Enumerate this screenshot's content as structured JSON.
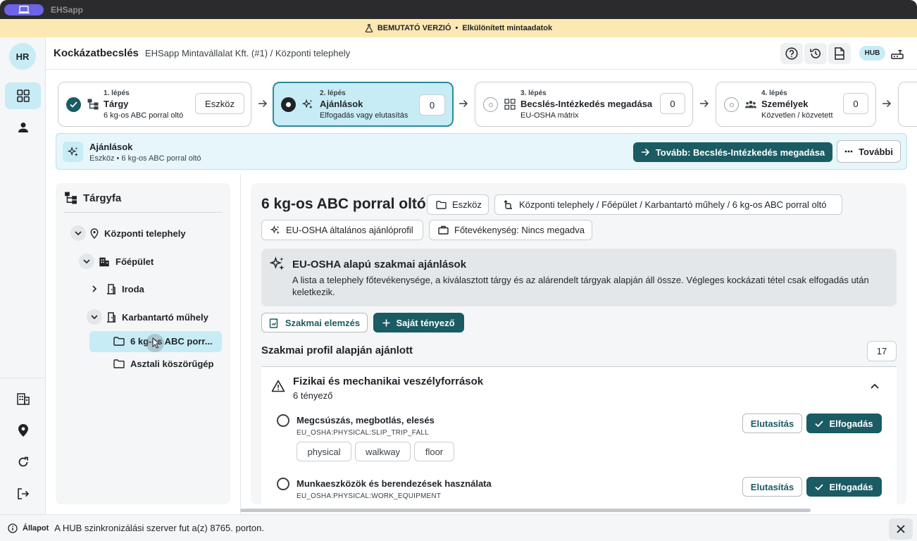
{
  "app": {
    "name": "EHSapp"
  },
  "banner": {
    "label": "BEMUTATÓ VERZIÓ",
    "separator": "•",
    "detail": "Elkülönített mintaadatok"
  },
  "user": {
    "initials": "HR"
  },
  "rail": {
    "top_items": [
      "dashboard-grid-icon",
      "person-icon"
    ],
    "bottom_items": [
      "building-icon",
      "location-pin-icon",
      "refresh-icon",
      "logout-icon"
    ]
  },
  "header": {
    "title": "Kockázatbecslés",
    "breadcrumb": "EHSapp Mintavállalat Kft. (#1) / Központi telephely",
    "hub_label": "HUB",
    "icons": [
      "help-icon",
      "history-icon",
      "report-icon",
      "network-icon"
    ]
  },
  "steps": [
    {
      "num": "1. lépés",
      "name": "Tárgy",
      "sub": "6 kg-os ABC porral oltó",
      "box": "Eszköz",
      "state": "done"
    },
    {
      "num": "2. lépés",
      "name": "Ajánlások",
      "sub": "Elfogadás vagy elutasítás",
      "box": "0",
      "state": "active"
    },
    {
      "num": "3. lépés",
      "name": "Becslés-Intézkedés megadása",
      "sub": "EU-OSHA mátrix",
      "box": "0",
      "state": "todo"
    },
    {
      "num": "4. lépés",
      "name": "Személyek",
      "sub": "Közvetlen / közvetett",
      "box": "0",
      "state": "todo"
    }
  ],
  "strip": {
    "title": "Ajánlások",
    "sub": "Eszköz • 6 kg-os ABC porral oltó",
    "next_label": "Tovább: Becslés-Intézkedés megadása",
    "more_label": "További"
  },
  "tree": {
    "title": "Tárgyfa",
    "nodes": {
      "site": "Központi telephely",
      "building": "Főépület",
      "office": "Iroda",
      "workshop": "Karbantartó műhely",
      "extinguisher": "6 kg-os ABC porr...",
      "grinder": "Asztali köszörűgép"
    }
  },
  "subject": {
    "title": "6 kg-os ABC porral oltó",
    "type_chip": "Eszköz",
    "path_chip": "Központi telephely / Főépület / Karbantartó műhely / 6 kg-os ABC porral oltó",
    "profile_chip": "EU-OSHA általános ajánlóprofil",
    "activity_chip": "Főtevékenység: Nincs megadva"
  },
  "recommendations": {
    "title": "EU-OSHA alapú szakmai ajánlások",
    "text": "A lista a telephely főtevékenysége, a kiválasztott tárgy és az alárendelt tárgyak alapján áll össze. Végleges kockázati tétel csak elfogadás után keletkezik.",
    "analysis_button": "Szakmai elemzés",
    "own_factor_button": "Saját tényező"
  },
  "profile_section": {
    "title": "Szakmai profil alapján ajánlott",
    "count": "17"
  },
  "group": {
    "title": "Fizikai és mechanikai veszélyforrások",
    "sub": "6 tényező",
    "items": [
      {
        "title": "Megcsúszás, megbotlás, elesés",
        "code": "EU_OSHA:PHYSICAL:SLIP_TRIP_FALL",
        "tags": [
          "physical",
          "walkway",
          "floor"
        ]
      },
      {
        "title": "Munkaeszközök és berendezések használata",
        "code": "EU_OSHA:PHYSICAL:WORK_EQUIPMENT"
      }
    ],
    "reject_label": "Elutasítás",
    "accept_label": "Elfogadás"
  },
  "statusbar": {
    "label": "Állapot",
    "text": "A HUB szinkronizálási szerver fut a(z) 8765. porton."
  }
}
